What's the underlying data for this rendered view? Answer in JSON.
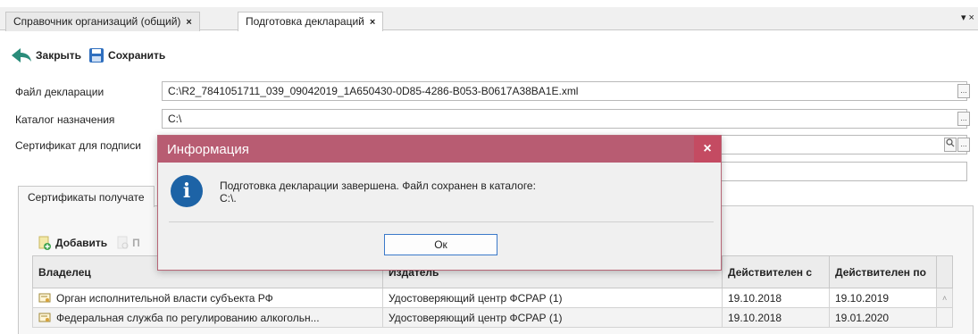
{
  "tabs": [
    {
      "label": "Справочник организаций (общий)",
      "close": "×"
    },
    {
      "label": "Подготовка деклараций",
      "close": "×"
    }
  ],
  "tabbar_menu": "▾ ×",
  "toolbar": {
    "close_label": "Закрыть",
    "save_label": "Сохранить"
  },
  "form": {
    "declaration_file_label": "Файл декларации",
    "declaration_file_value": "C:\\R2_7841051711_039_09042019_1A650430-0D85-4286-B053-B0617A38BA1E.xml",
    "target_dir_label": "Каталог назначения",
    "target_dir_value": "C:\\",
    "cert_label": "Сертификат для подписи",
    "ellipsis": "..."
  },
  "panel": {
    "tab_label": "Сертификаты получате",
    "add_label": "Добавить",
    "second_label": "П"
  },
  "grid": {
    "headers": [
      "Владелец",
      "Издатель",
      "Действителен с",
      "Действителен по"
    ],
    "rows": [
      {
        "owner": "Орган исполнительной власти субъекта РФ",
        "issuer": "Удостоверяющий центр ФСРАР (1)",
        "from": "19.10.2018",
        "to": "19.10.2019"
      },
      {
        "owner": "Федеральная служба по регулированию алкогольн...",
        "issuer": "Удостоверяющий центр ФСРАР (1)",
        "from": "19.10.2018",
        "to": "19.01.2020"
      }
    ]
  },
  "dialog": {
    "title": "Информация",
    "close": "×",
    "icon_glyph": "i",
    "message_line1": "Подготовка декларации завершена. Файл сохранен в каталоге:",
    "message_line2": "C:\\.",
    "ok_label": "Ок"
  },
  "colors": {
    "dialog_title": "#b85c72",
    "dialog_close": "#c44b62",
    "info_icon": "#1d63a6",
    "back_arrow": "#2a8c7a",
    "save_icon": "#2f6fbf"
  }
}
